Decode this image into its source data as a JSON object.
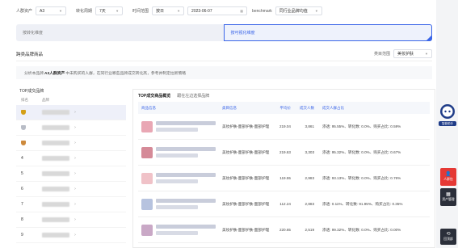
{
  "filters": {
    "crowd_label": "人群资产",
    "crowd_value": "A3",
    "period_label": "转化周期",
    "period_value": "7天",
    "stat_label": "时间范围",
    "stat_value": "按日",
    "date_value": "2023-06-07",
    "bench_label": "benchmark",
    "bench_value": "同行业品牌均值"
  },
  "toggles": {
    "left": "按转化维度",
    "right": "按可视化维度"
  },
  "section": {
    "title": "跨类品牌商品",
    "right_label": "类目范围",
    "right_value": "美妆护肤"
  },
  "desc": {
    "pre": "分析本品牌",
    "bold": "A3人群资产",
    "post": "中未购买的人群，在同行业哪些品牌成交转化高，参考并制定拉新策略"
  },
  "left_panel": {
    "title": "TOP成交品牌",
    "col_rank": "排名",
    "col_brand": "品牌",
    "ranks": [
      "1",
      "2",
      "3",
      "4",
      "5",
      "6",
      "7",
      "8",
      "9"
    ]
  },
  "right_panel": {
    "tab_active": "TOP成交商品概览",
    "tab_other": "跟在左边选择品牌",
    "headers": {
      "product": "商品信息",
      "category": "类目信息",
      "price": "平均价",
      "qty": "成交人数",
      "share": "成交人群占比"
    },
    "rows": [
      {
        "category": "美妆护肤-面部护肤-面部护理",
        "price": "219.04",
        "qty": "3,861",
        "share": "渗透: 95.55%、转化数: 0.0%、购买占比: 0.59%"
      },
      {
        "category": "美妆护肤-面部护肤-面部护理",
        "price": "219.63",
        "qty": "3,303",
        "share": "渗透: 95.32%、转化数: 0.0%、购买占比: 0.67%"
      },
      {
        "category": "美妆护肤-面部护肤-面部护理",
        "price": "119.55",
        "qty": "2,983",
        "share": "渗透: 93.13%、转化数: 0.0%、购买占比: 0.76%"
      },
      {
        "category": "美妆护肤-面部护肤-面部护理",
        "price": "112.24",
        "qty": "2,883",
        "share": "渗透: 0.11%、转化数: 91.95%、购买占比: 0.35%"
      },
      {
        "category": "美妆护肤-面部护肤-面部护理",
        "price": "220.65",
        "qty": "2,519",
        "share": "渗透: 99.32%、转化数: 0.0%、购买占比: 0.00%"
      }
    ]
  },
  "side": {
    "assistant": "智能助手",
    "btn1": "人群包",
    "btn2": "资产管理",
    "btn3": "回顶部"
  },
  "colors": {
    "accent": "#3b66e8",
    "gold": "#d4a017",
    "silver": "#b8bcc6",
    "bronze": "#cd8a3c"
  }
}
